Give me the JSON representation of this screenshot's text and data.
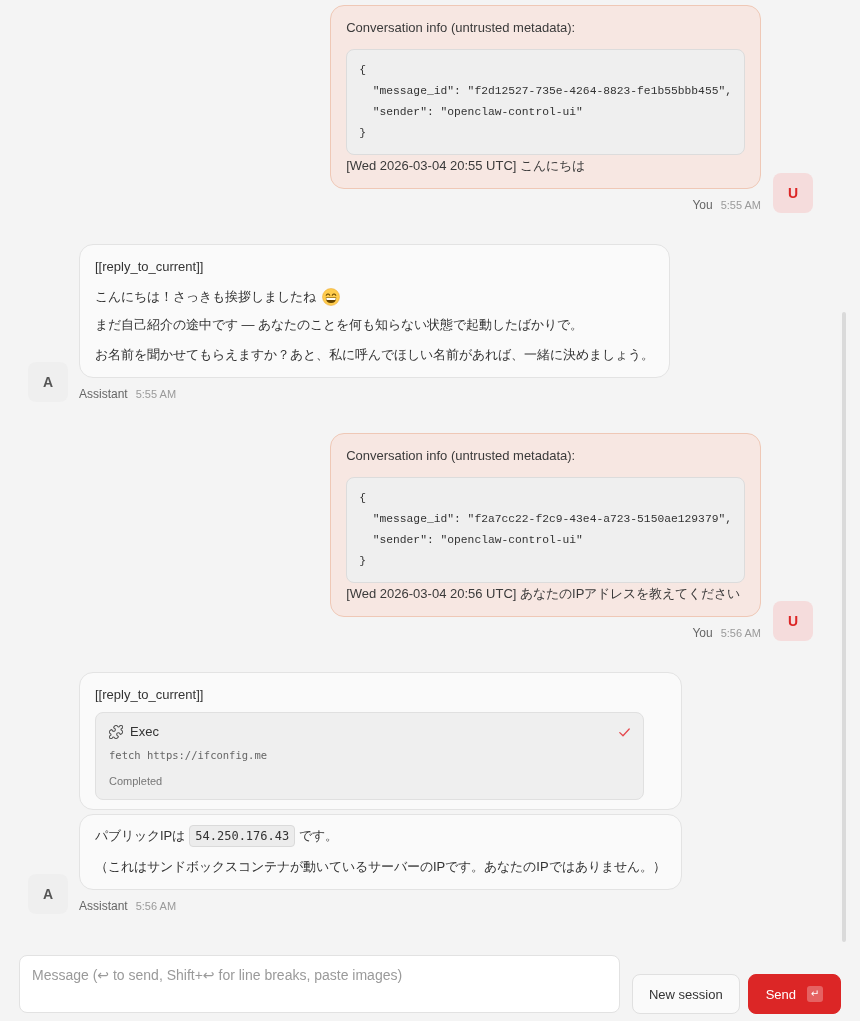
{
  "messages": [
    {
      "kind": "user",
      "avatar": "U",
      "sender": "You",
      "time": "5:55 AM",
      "bubbles": [
        {
          "blocks": [
            {
              "kind": "paragraph",
              "text": "Conversation info (untrusted metadata):"
            },
            {
              "kind": "code",
              "text": "{\n  \"message_id\": \"f2d12527-735e-4264-8823-fe1b55bbb455\",\n  \"sender\": \"openclaw-control-ui\"\n}"
            },
            {
              "kind": "paragraph",
              "text": "[Wed 2026-03-04 20:55 UTC] こんにちは"
            }
          ]
        }
      ]
    },
    {
      "kind": "assistant",
      "avatar": "A",
      "sender": "Assistant",
      "time": "5:55 AM",
      "bubbles": [
        {
          "blocks": [
            {
              "kind": "paragraph",
              "text": "[[reply_to_current]]"
            },
            {
              "kind": "paragraph",
              "text": "こんにちは！さっきも挨拶しましたね",
              "emoji": true
            },
            {
              "kind": "paragraph",
              "text": "まだ自己紹介の途中です — あなたのことを何も知らない状態で起動したばかりで。"
            },
            {
              "kind": "paragraph",
              "text": "お名前を聞かせてもらえますか？あと、私に呼んでほしい名前があれば、一緒に決めましょう。"
            }
          ]
        }
      ]
    },
    {
      "kind": "user",
      "avatar": "U",
      "sender": "You",
      "time": "5:56 AM",
      "bubbles": [
        {
          "blocks": [
            {
              "kind": "paragraph",
              "text": "Conversation info (untrusted metadata):"
            },
            {
              "kind": "code",
              "text": "{\n  \"message_id\": \"f2a7cc22-f2c9-43e4-a723-5150ae129379\",\n  \"sender\": \"openclaw-control-ui\"\n}"
            },
            {
              "kind": "paragraph",
              "text": "[Wed 2026-03-04 20:56 UTC] あなたのIPアドレスを教えてください"
            }
          ]
        }
      ]
    },
    {
      "kind": "assistant",
      "avatar": "A",
      "sender": "Assistant",
      "time": "5:56 AM",
      "bubbles": [
        {
          "blocks": [
            {
              "kind": "paragraph",
              "text": "[[reply_to_current]]"
            },
            {
              "kind": "tool",
              "name": "Exec",
              "command": "fetch https://ifconfig.me",
              "status": "Completed",
              "completed": true
            }
          ]
        },
        {
          "blocks": [
            {
              "kind": "inline",
              "parts": [
                {
                  "kind": "text",
                  "text": "パブリックIPは"
                },
                {
                  "kind": "code",
                  "text": "54.250.176.43"
                },
                {
                  "kind": "text",
                  "text": "です。"
                }
              ]
            },
            {
              "kind": "paragraph",
              "text": "（これはサンドボックスコンテナが動いているサーバーのIPです。あなたのIPではありません。）"
            }
          ]
        }
      ]
    }
  ],
  "composer": {
    "placeholder": "Message (↩ to send, Shift+↩ for line breaks, paste images)",
    "new_session": "New session",
    "send": "Send",
    "send_shortcut": "↵"
  }
}
